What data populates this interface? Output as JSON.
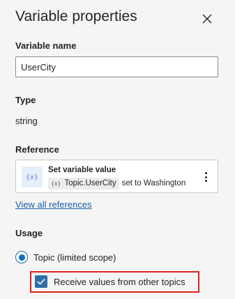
{
  "panel": {
    "title": "Variable properties",
    "close_icon": "close-icon"
  },
  "variable_name": {
    "label": "Variable name",
    "value": "UserCity"
  },
  "type": {
    "label": "Type",
    "value": "string"
  },
  "reference": {
    "label": "Reference",
    "card": {
      "icon_text": "{x}",
      "title": "Set variable value",
      "chip_icon_text": "{x}",
      "chip_text": "Topic.UserCity",
      "suffix": "set to Washington"
    },
    "view_all_label": "View all references"
  },
  "usage": {
    "label": "Usage",
    "radio_label": "Topic (limited scope)",
    "radio_selected": true,
    "checkbox_label": "Receive values from other topics",
    "checkbox_checked": true
  },
  "colors": {
    "accent": "#0f6cbd",
    "highlight": "#e0201c",
    "link": "#1a5fa8"
  }
}
